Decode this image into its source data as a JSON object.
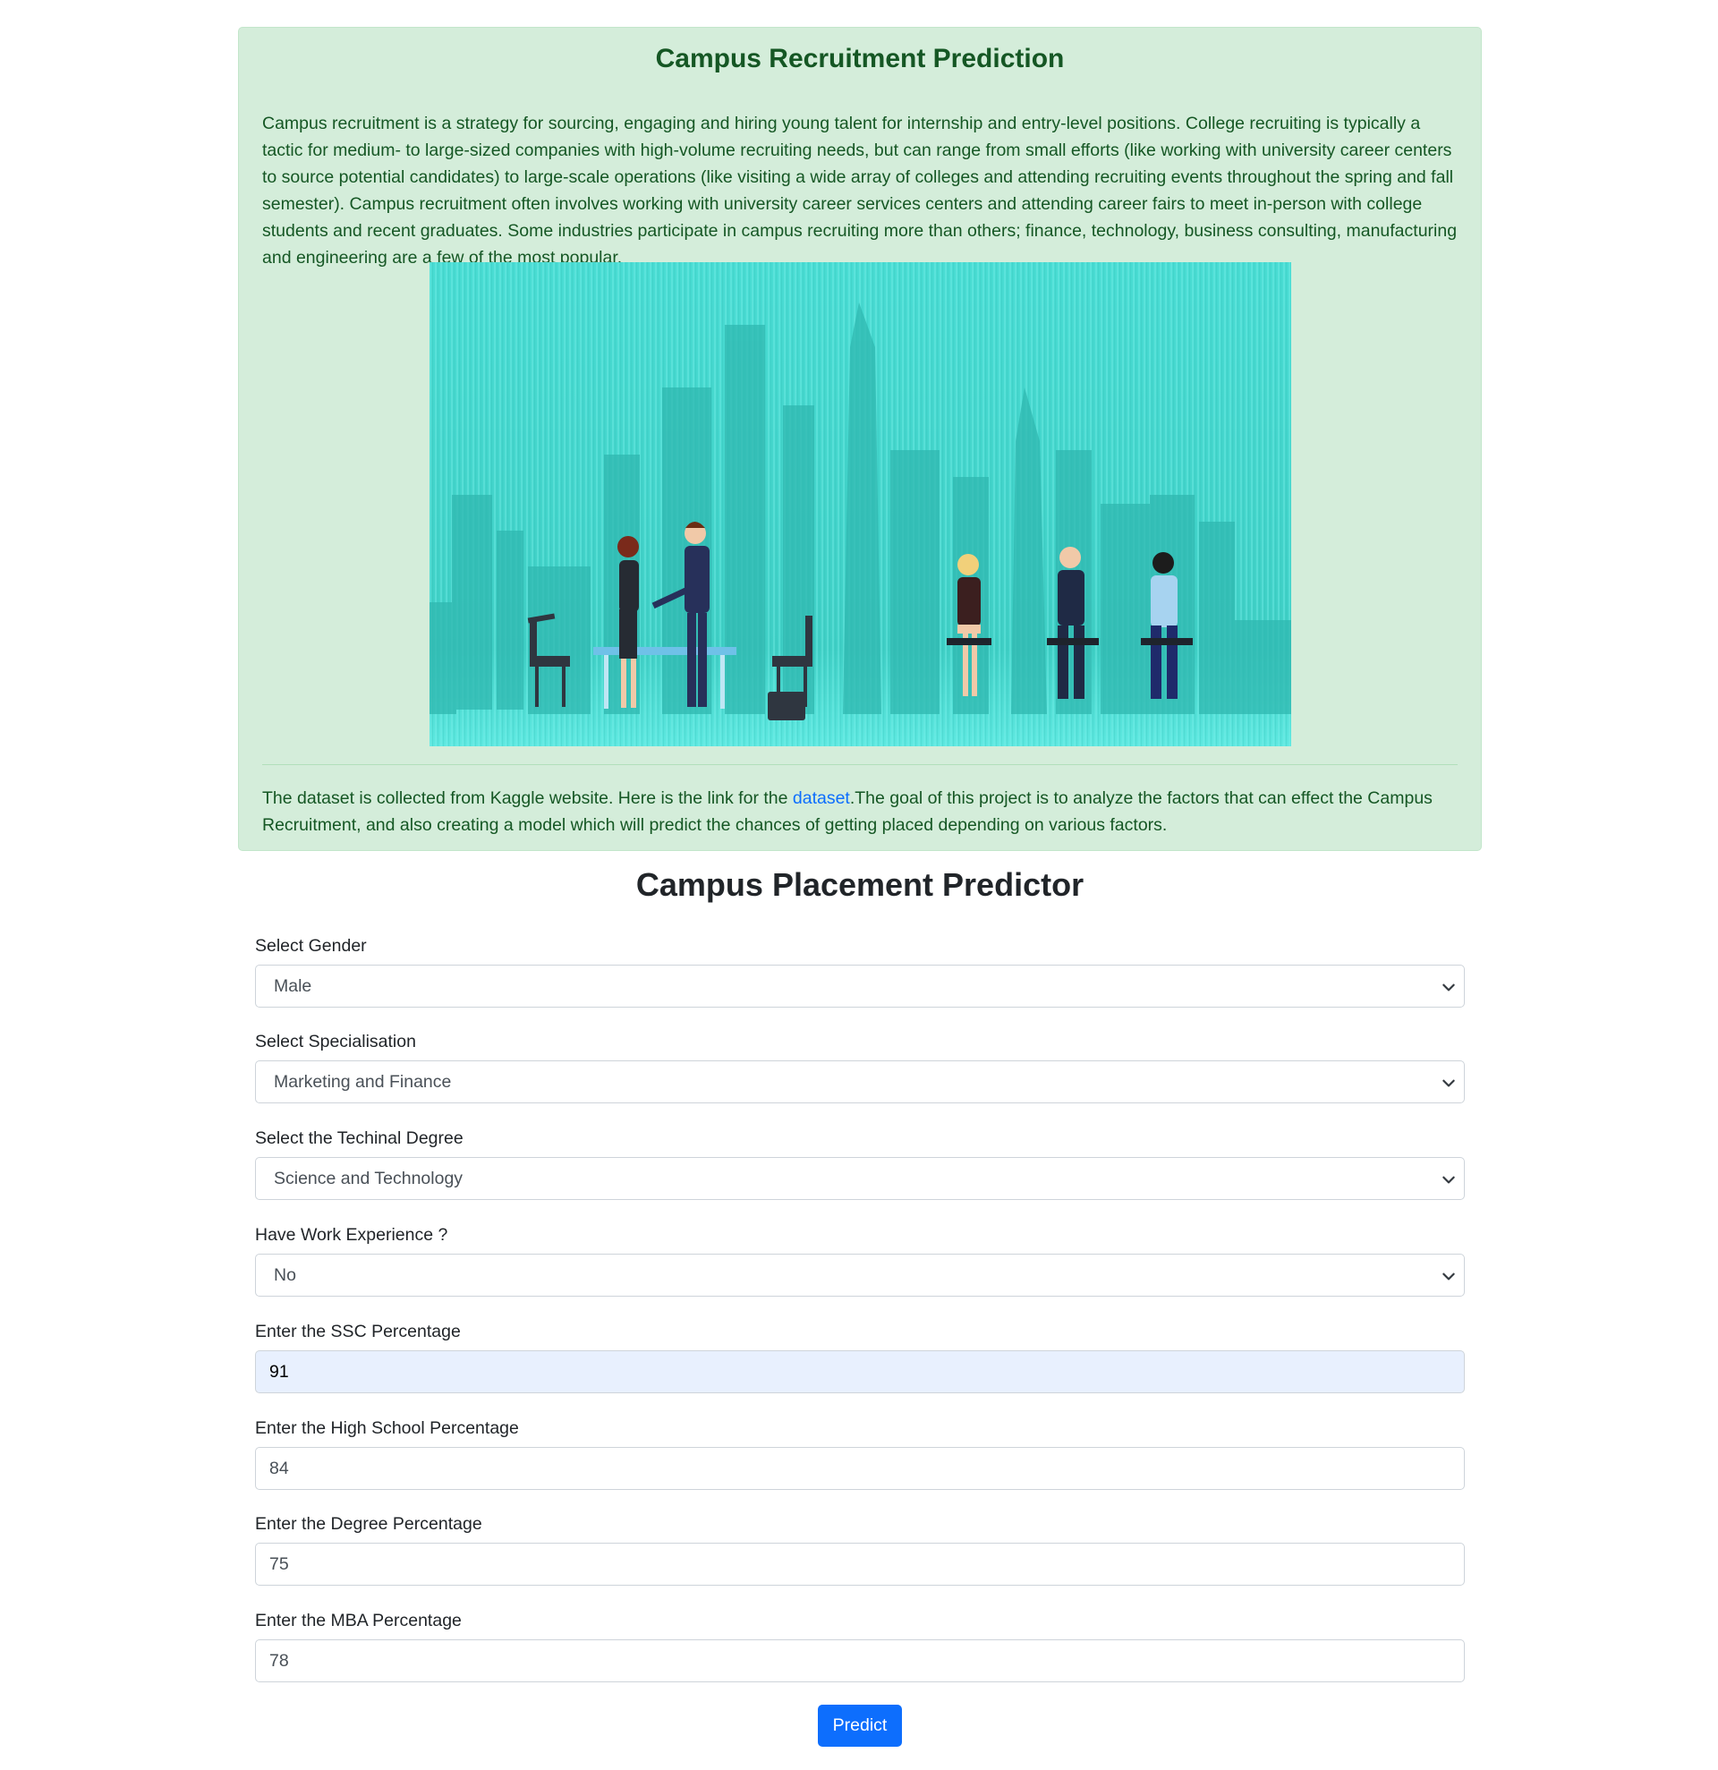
{
  "header": {
    "title": "Campus Recruitment Prediction",
    "description": "Campus recruitment is a strategy for sourcing, engaging and hiring young talent for internship and entry-level positions. College recruiting is typically a tactic for medium- to large-sized companies with high-volume recruiting needs, but can range from small efforts (like working with university career centers to source potential candidates) to large-scale operations (like visiting a wide array of colleges and attending recruiting events throughout the spring and fall semester). Campus recruitment often involves working with university career services centers and attending career fairs to meet in-person with college students and recent graduates. Some industries participate in campus recruiting more than others; finance, technology, business consulting, manufacturing and engineering are a few of the most popular.",
    "footer_before": "The dataset is collected from Kaggle website. Here is the link for the ",
    "footer_link": "dataset",
    "footer_after": ".The goal of this project is to analyze the factors that can effect the Campus Recruitment, and also creating a model which will predict the chances of getting placed depending on various factors."
  },
  "form": {
    "title": "Campus Placement Predictor",
    "gender": {
      "label": "Select Gender",
      "value": "Male"
    },
    "specialisation": {
      "label": "Select Specialisation",
      "value": "Marketing and Finance"
    },
    "degree_type": {
      "label": "Select the Techinal Degree",
      "value": "Science and Technology"
    },
    "work_experience": {
      "label": "Have Work Experience ?",
      "value": "No"
    },
    "ssc": {
      "label": "Enter the SSC Percentage",
      "value": "91"
    },
    "high_school": {
      "label": "Enter the High School Percentage",
      "value": "84"
    },
    "degree": {
      "label": "Enter the Degree Percentage",
      "value": "75"
    },
    "mba": {
      "label": "Enter the MBA Percentage",
      "value": "78"
    },
    "submit_label": "Predict"
  },
  "colors": {
    "alert_bg": "#d4edda",
    "alert_text": "#155724",
    "link": "#0d6efd",
    "button": "#0d6efd",
    "autofill_bg": "#e8f0fe"
  }
}
